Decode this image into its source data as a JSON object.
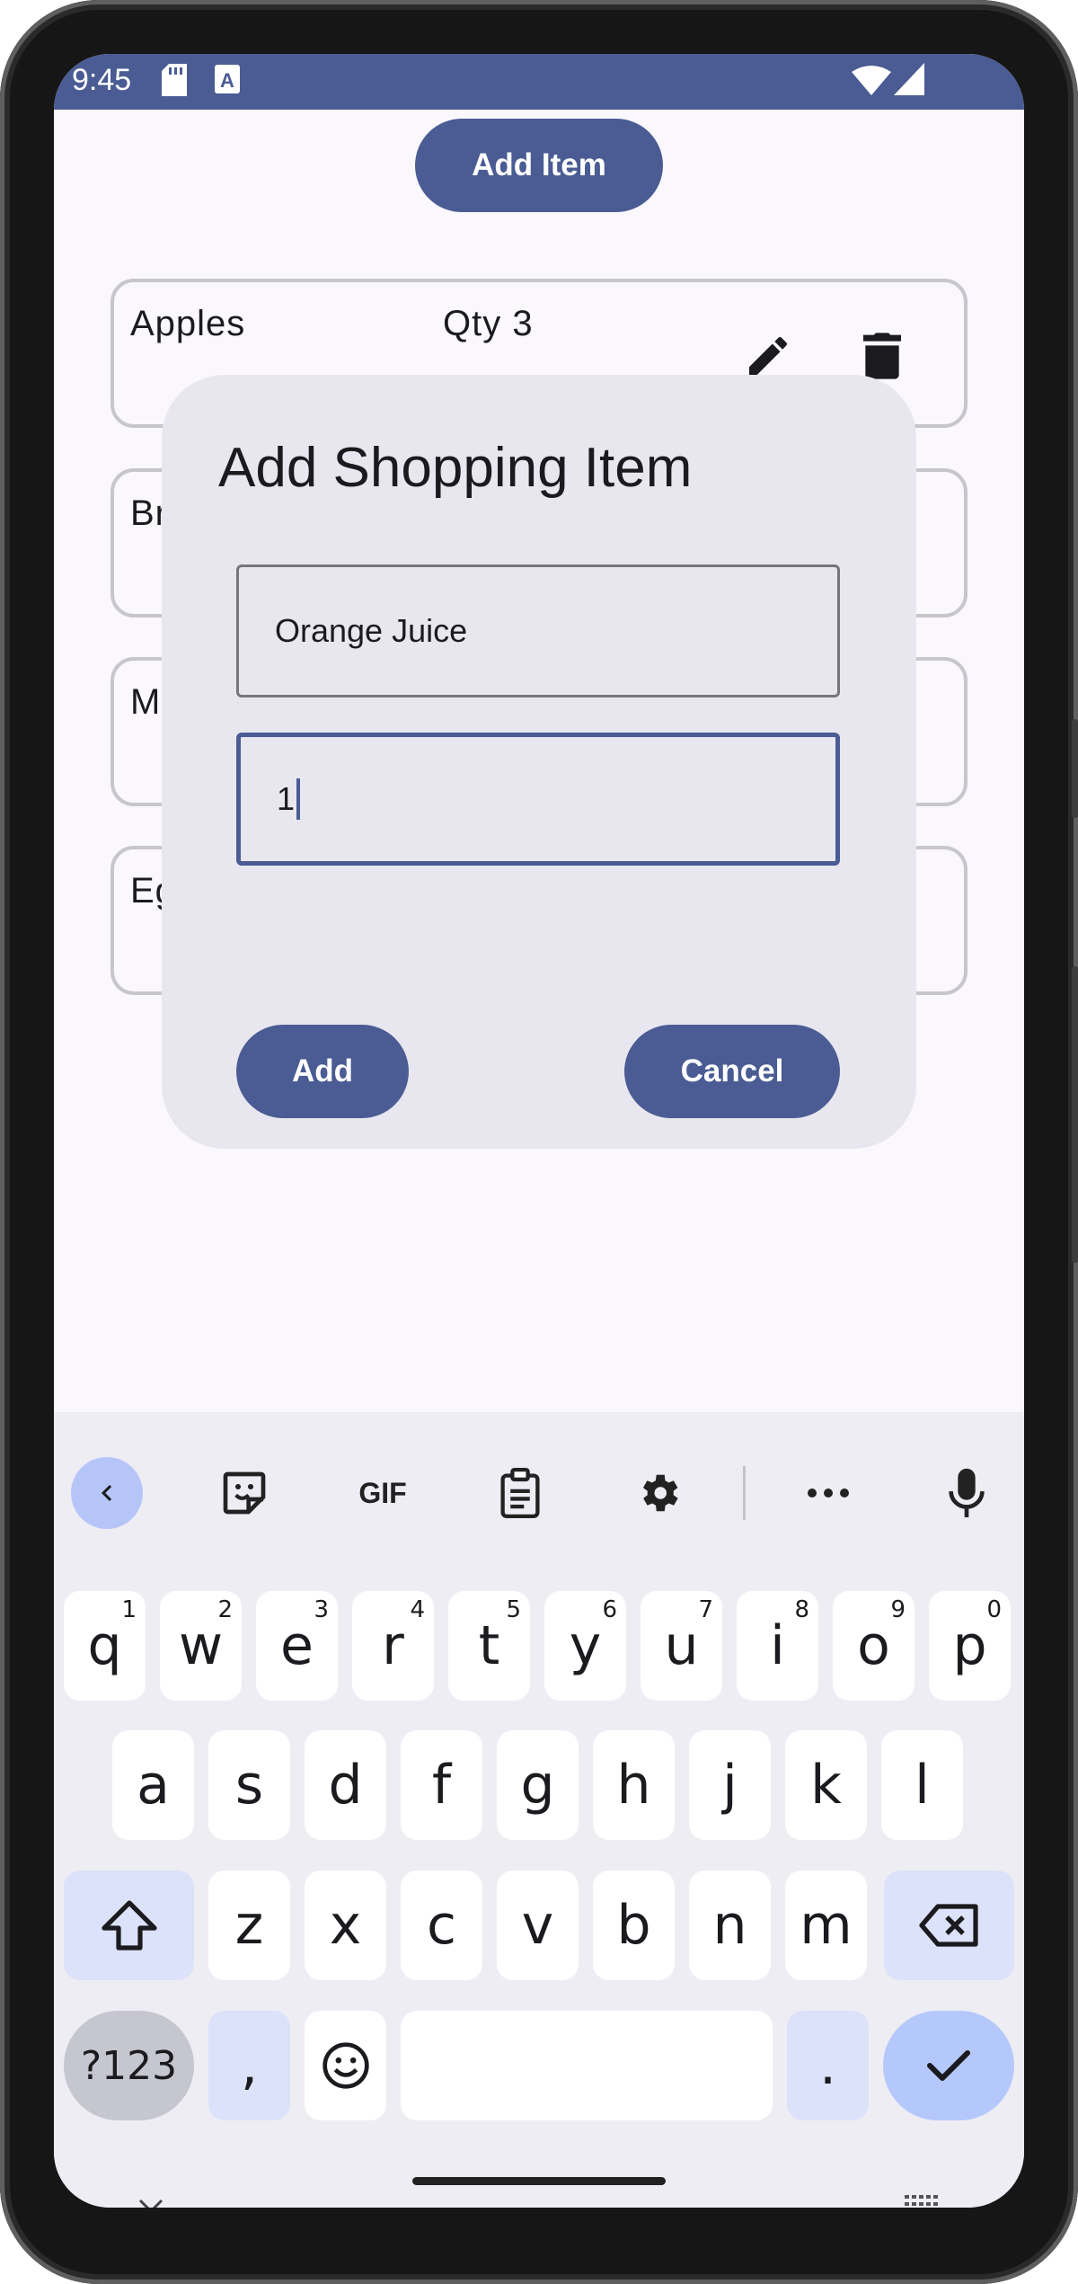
{
  "status_bar": {
    "time": "9:45",
    "color": "#4a5c93"
  },
  "app": {
    "add_item_label": "Add Item",
    "items": [
      {
        "name": "Apples",
        "qty": "Qty 3"
      },
      {
        "name": "Br",
        "qty": ""
      },
      {
        "name": "M",
        "qty": ""
      },
      {
        "name": "Eg",
        "qty": ""
      }
    ]
  },
  "dialog": {
    "title": "Add Shopping Item",
    "name_value": "Orange Juice",
    "qty_value": "1",
    "add_label": "Add",
    "cancel_label": "Cancel"
  },
  "keyboard": {
    "toolbar": [
      "back-icon",
      "sticker-icon",
      "gif-icon",
      "clipboard-icon",
      "gear-icon",
      "more-icon",
      "mic-icon"
    ],
    "gif_label": "GIF",
    "row1": [
      {
        "key": "q",
        "hint": "1"
      },
      {
        "key": "w",
        "hint": "2"
      },
      {
        "key": "e",
        "hint": "3"
      },
      {
        "key": "r",
        "hint": "4"
      },
      {
        "key": "t",
        "hint": "5"
      },
      {
        "key": "y",
        "hint": "6"
      },
      {
        "key": "u",
        "hint": "7"
      },
      {
        "key": "i",
        "hint": "8"
      },
      {
        "key": "o",
        "hint": "9"
      },
      {
        "key": "p",
        "hint": "0"
      }
    ],
    "row2": [
      "a",
      "s",
      "d",
      "f",
      "g",
      "h",
      "j",
      "k",
      "l"
    ],
    "row3": [
      "z",
      "x",
      "c",
      "v",
      "b",
      "n",
      "m"
    ],
    "symbols_label": "?123",
    "comma_label": ",",
    "period_label": ".",
    "accent_color": "#b5c8fb"
  }
}
